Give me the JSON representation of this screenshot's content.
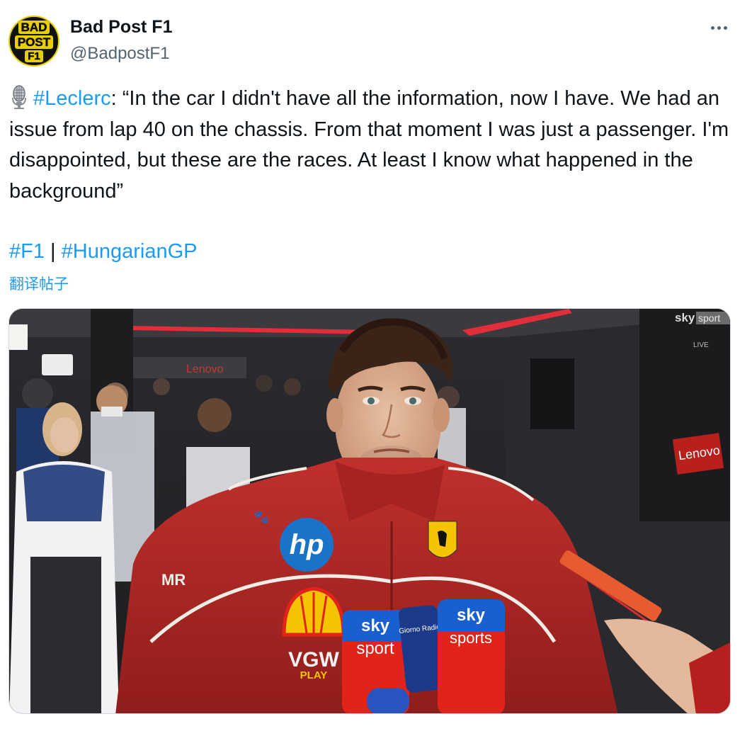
{
  "author": {
    "avatar_lines": [
      "BAD",
      "POST",
      "F1"
    ],
    "display_name": "Bad Post F1",
    "handle": "@BadpostF1"
  },
  "actions": {
    "more_icon": "more-horizontal-icon"
  },
  "tweet": {
    "mic_icon": "studio-microphone-emoji",
    "mention_tag": "#Leclerc",
    "quote_text": ": “In the car I didn't have all the information, now I have. We had an issue from lap 40 on the chassis. From that moment I was just a passenger. I'm disappointed, but these are the races. At least I know what happened in the background”",
    "tag1": "#F1",
    "separator": "|",
    "tag2": "#HungarianGP",
    "translate_label": "翻译帖子"
  },
  "media": {
    "broadcaster_logo": "sky sport",
    "live_label": "LIVE",
    "shirt_logos": [
      "hp",
      "VGW",
      "PLAY"
    ],
    "microphone_labels": [
      "sky",
      "sport",
      "sky",
      "sports",
      "Giorno Radio"
    ],
    "background_sign": "Lenovo",
    "colors": {
      "suit_red": "#b32624",
      "sky_blue": "#1a5fd0",
      "sky_red": "#e2231a",
      "hp_blue": "#1a73c8",
      "shell_yellow": "#f5c400"
    }
  }
}
